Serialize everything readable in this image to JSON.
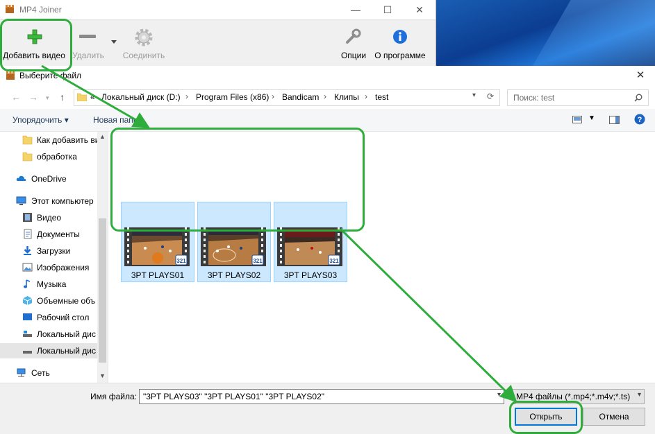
{
  "app": {
    "title": "MP4 Joiner",
    "toolbar": {
      "add": "Добавить видео",
      "remove": "Удалить",
      "join": "Соединить",
      "options": "Опции",
      "about": "О программе"
    }
  },
  "dialog": {
    "title": "Выберите файл",
    "breadcrumb": [
      "«",
      "Локальный диск (D:)",
      "Program Files (x86)",
      "Bandicam",
      "Клипы",
      "test"
    ],
    "search_placeholder": "Поиск: test",
    "organize": "Упорядочить",
    "new_folder": "Новая папка",
    "nav": [
      {
        "label": "Как добавить ви",
        "icon": "folder-icon"
      },
      {
        "label": "обработка",
        "icon": "folder-icon"
      },
      {
        "label": "OneDrive",
        "icon": "cloud-icon"
      },
      {
        "label": "Этот компьютер",
        "icon": "computer-icon"
      },
      {
        "label": "Видео",
        "icon": "video-icon"
      },
      {
        "label": "Документы",
        "icon": "documents-icon"
      },
      {
        "label": "Загрузки",
        "icon": "download-icon"
      },
      {
        "label": "Изображения",
        "icon": "images-icon"
      },
      {
        "label": "Музыка",
        "icon": "music-icon"
      },
      {
        "label": "Объемные объ",
        "icon": "3d-objects-icon"
      },
      {
        "label": "Рабочий стол",
        "icon": "desktop-icon"
      },
      {
        "label": "Локальный дис",
        "icon": "drive-icon"
      },
      {
        "label": "Локальный дис",
        "icon": "drive-icon"
      },
      {
        "label": "Сеть",
        "icon": "network-icon"
      }
    ],
    "files": [
      "3PT PLAYS01",
      "3PT PLAYS02",
      "3PT PLAYS03"
    ],
    "badge": "321",
    "filename_label": "Имя файла:",
    "filename_value": "\"3PT PLAYS03\" \"3PT PLAYS01\" \"3PT PLAYS02\"",
    "filter": "MP4 файлы (*.mp4;*.m4v;*.ts)",
    "open": "Открыть",
    "cancel": "Отмена"
  },
  "colors": {
    "highlight": "#2eac3c",
    "selection": "#cce8ff",
    "accent": "#0078d7"
  }
}
